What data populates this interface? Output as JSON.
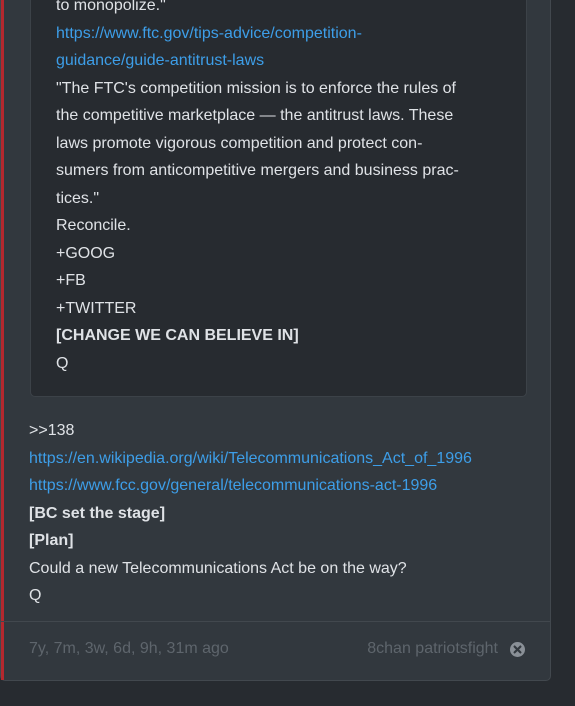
{
  "quote": {
    "lines": [
      "to monopolize.\"",
      "https://www.ftc.gov/tips-advice/competition-",
      "guidance/guide-antitrust-laws",
      "\"The FTC's competition mission is to enforce the rules of",
      "the competitive marketplace — the antitrust laws. These",
      "laws promote vigorous competition and protect con-",
      "sumers from anticompetitive mergers and business prac-",
      "tices.\"",
      "Reconcile.",
      "+GOOG",
      "+FB",
      "+TWITTER",
      "[CHANGE WE CAN BELIEVE IN]",
      "Q"
    ]
  },
  "post": {
    "lines": [
      ">>138",
      "https://en.wikipedia.org/wiki/Telecommunications_Act_of_1996",
      "https://www.fcc.gov/general/telecommunications-act-1996",
      "[BC set the stage]",
      "[Plan]",
      "Could a new Telecommunications Act be on the way?",
      "Q"
    ]
  },
  "footer": {
    "time": "7y, 7m, 3w, 6d, 9h, 31m ago",
    "source": "8chan patriotsfight"
  },
  "colors": {
    "link": "#3d9ee8",
    "accent_bar": "#b4282e"
  },
  "icons": {
    "close": "close-circle-icon"
  }
}
